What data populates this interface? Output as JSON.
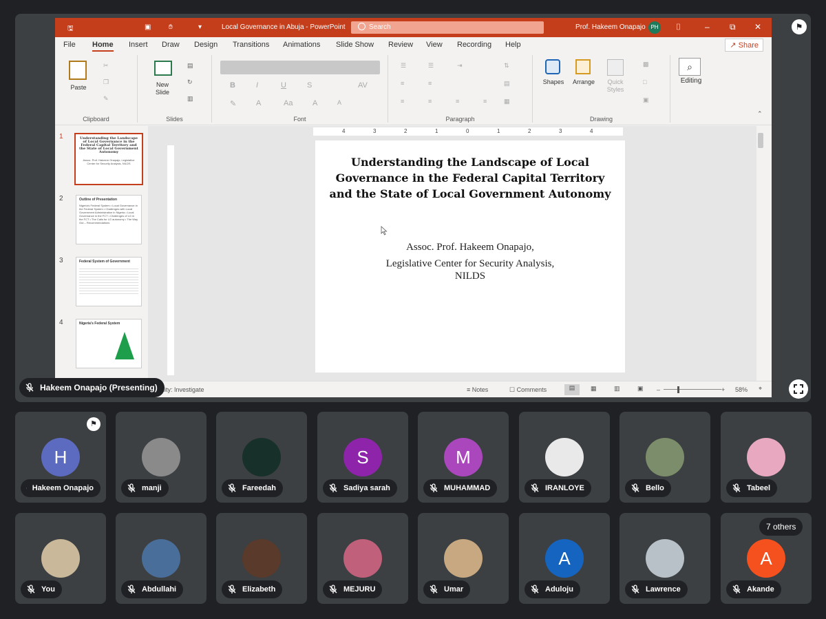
{
  "powerpoint": {
    "window_title": "Local Governance in Abuja - PowerPoint",
    "search_placeholder": "Search",
    "user_name": "Prof. Hakeem Onapajo",
    "user_initials": "PH",
    "menu": [
      "File",
      "Home",
      "Insert",
      "Draw",
      "Design",
      "Transitions",
      "Animations",
      "Slide Show",
      "Review",
      "View",
      "Recording",
      "Help"
    ],
    "share_label": "Share",
    "ribbon_groups": {
      "clipboard": "Clipboard",
      "slides": "Slides",
      "font": "Font",
      "paragraph": "Paragraph",
      "drawing": "Drawing"
    },
    "ribbon_buttons": {
      "paste": "Paste",
      "new_slide": "New\nSlide",
      "shapes": "Shapes",
      "arrange": "Arrange",
      "quick_styles": "Quick\nStyles",
      "editing": "Editing"
    },
    "ruler_ticks": [
      "4",
      "3",
      "2",
      "1",
      "0",
      "1",
      "2",
      "3",
      "4"
    ],
    "thumbnails": [
      {
        "num": "1",
        "title": "Understanding the Landscape of Local Governance in the Federal Capital Territory and the State of Local Government Autonomy",
        "body": "Assoc. Prof. Hakeem Onapajo, Legislative Center for Security Analysis, NILDS"
      },
      {
        "num": "2",
        "title": "Outline of Presentation",
        "body": "Nigeria's Federal System • Local Governance in the Federal System • Challenges with Local Government Administration in Nigeria • Local Governance in the FCT • Challenges of LG in the FCT • The Calls for LG autonomy • The Way Out – Recommendations"
      },
      {
        "num": "3",
        "title": "Federal System of Government",
        "body": ""
      },
      {
        "num": "4",
        "title": "Nigeria's Federal System",
        "body": ""
      }
    ],
    "slide": {
      "title": "Understanding the Landscape of Local Governance in the Federal Capital Territory and the State of Local Government Autonomy",
      "subtitle_line1": "Assoc. Prof. Hakeem Onapajo,",
      "subtitle_line2": "Legislative Center for Security Analysis,",
      "subtitle_line3": "NILDS"
    },
    "status": {
      "accessibility": "bility: Investigate",
      "notes": "Notes",
      "comments": "Comments",
      "zoom": "58%"
    }
  },
  "meeting": {
    "presenter_label": "Hakeem Onapajo (Presenting)",
    "others_label": "7 others",
    "participants": [
      {
        "name": "Hakeem Onapajo",
        "initial": "H",
        "color": "#5c6bc0"
      },
      {
        "name": "manji",
        "initial": "",
        "color": "#8a8a8a"
      },
      {
        "name": "Fareedah",
        "initial": "",
        "color": "#17302a"
      },
      {
        "name": "Sadiya sarah",
        "initial": "S",
        "color": "#8e24aa"
      },
      {
        "name": "MUHAMMAD",
        "initial": "M",
        "color": "#ab47bc"
      },
      {
        "name": "IRANLOYE",
        "initial": "",
        "color": "#e9e9e9"
      },
      {
        "name": "Bello",
        "initial": "",
        "color": "#7b8d6a"
      },
      {
        "name": "Tabeel",
        "initial": "",
        "color": "#e7a8c0"
      },
      {
        "name": "You",
        "initial": "",
        "color": "#c9b89a"
      },
      {
        "name": "Abdullahi",
        "initial": "",
        "color": "#4a6e9a"
      },
      {
        "name": "Elizabeth",
        "initial": "",
        "color": "#5a3a2a"
      },
      {
        "name": "MEJURU",
        "initial": "",
        "color": "#c0607a"
      },
      {
        "name": "Umar",
        "initial": "",
        "color": "#c8a880"
      },
      {
        "name": "Aduloju",
        "initial": "A",
        "color": "#1565c0"
      },
      {
        "name": "Lawrence",
        "initial": "",
        "color": "#b8c0c8"
      },
      {
        "name": "Akande",
        "initial": "A",
        "color": "#f4511e"
      }
    ]
  }
}
